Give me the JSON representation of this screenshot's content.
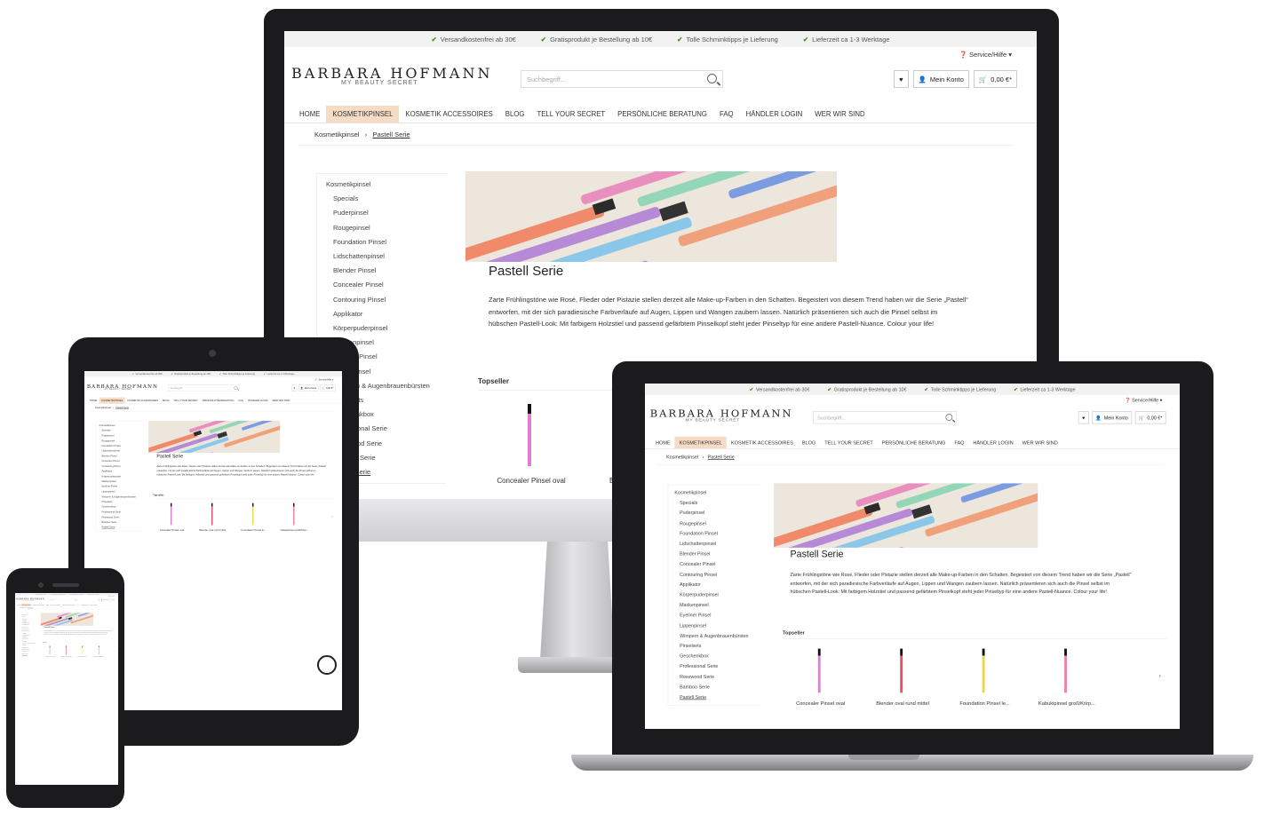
{
  "topbar": [
    "Versandkostenfrei ab 30€",
    "Gratisprodukt je Bestellung ab 10€",
    "Tolle Schminktipps je Lieferung",
    "Lieferzeit ca 1-3 Werktage"
  ],
  "service_label": "Service/Hilfe",
  "logo": {
    "name": "BARBARA HOFMANN",
    "sub": "MY BEAUTY SECRET"
  },
  "search": {
    "placeholder": "Suchbegriff..."
  },
  "account_label": "Mein Konto",
  "cart_label": "0,00 €*",
  "nav": [
    "HOME",
    "KOSMETIKPINSEL",
    "KOSMETIK ACCESSOIRES",
    "BLOG",
    "TELL YOUR SECRET",
    "PERSÖNLICHE BERATUNG",
    "FAQ",
    "HÄNDLER LOGIN",
    "WER WIR SIND"
  ],
  "breadcrumb": {
    "parent": "Kosmetikpinsel",
    "separator": "›",
    "current": "Pastell Serie"
  },
  "sidebar": {
    "heading": "Kosmetikpinsel",
    "items": [
      "Specials",
      "Puderpinsel",
      "Rougepinsel",
      "Foundation Pinsel",
      "Lidschattenpinsel",
      "Blender Pinsel",
      "Concealer Pinsel",
      "Contouring Pinsel",
      "Applikator",
      "Körperpuderpinsel",
      "Maskenpinsel",
      "Eyeliner Pinsel",
      "Lippenpinsel",
      "Wimpern & Augenbrauenbürsten",
      "Pinselsets",
      "Geschenkbox",
      "Professional Serie",
      "Rosewood Serie",
      "Bamboo Serie",
      "Pastell Serie"
    ]
  },
  "category": {
    "title": "Pastell Serie",
    "description": "Zarte Frühlingstöne wie Rosé, Flieder oder Pistazie stellen derzeit alle Make-up-Farben in den Schatten. Begeistert von diesem Trend haben wir die Serie „Pastell“ entworfen, mit der sich paradiesische Farbverläufe auf Augen, Lippen und Wangen zaubern lassen. Natürlich präsentieren sich auch die Pinsel selbst im hübschen Pastell-Look: Mit farbigem Holzstiel und passend gefärbtem Pinselkopf steht jeder Pinseltyp für eine andere Pastell-Nuance. Colour your life!"
  },
  "topseller": {
    "heading": "Topseller",
    "products": [
      {
        "name": "Concealer Pinsel oval",
        "color": "#e37dcf"
      },
      {
        "name": "Blender oval rund mittel",
        "color": "#e8506a"
      },
      {
        "name": "Foundation Pinsel le...",
        "color": "#e8d84a"
      },
      {
        "name": "Kabukipinsel groß/Körp...",
        "color": "#ef7fa4"
      }
    ]
  },
  "colors": {
    "accent_nav": "#f6dcc4",
    "bezel": "#1b1b1d",
    "check": "#4a8a2a"
  }
}
